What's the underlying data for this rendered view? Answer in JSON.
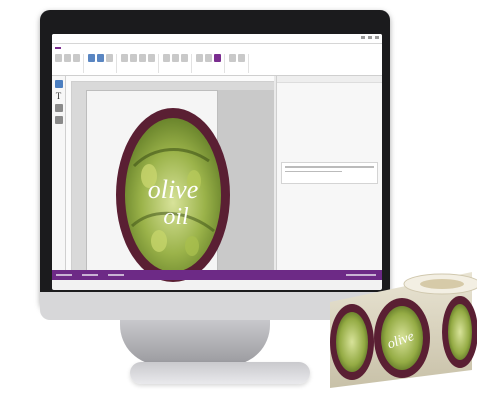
{
  "label": {
    "headline_1": "olive",
    "headline_2": "oil",
    "roll_script": "olive"
  },
  "colors": {
    "accent": "#7a2d8f",
    "label_border": "#5a1f33",
    "olive": "#9bb34a"
  },
  "icons": {
    "text_tool": "T"
  }
}
